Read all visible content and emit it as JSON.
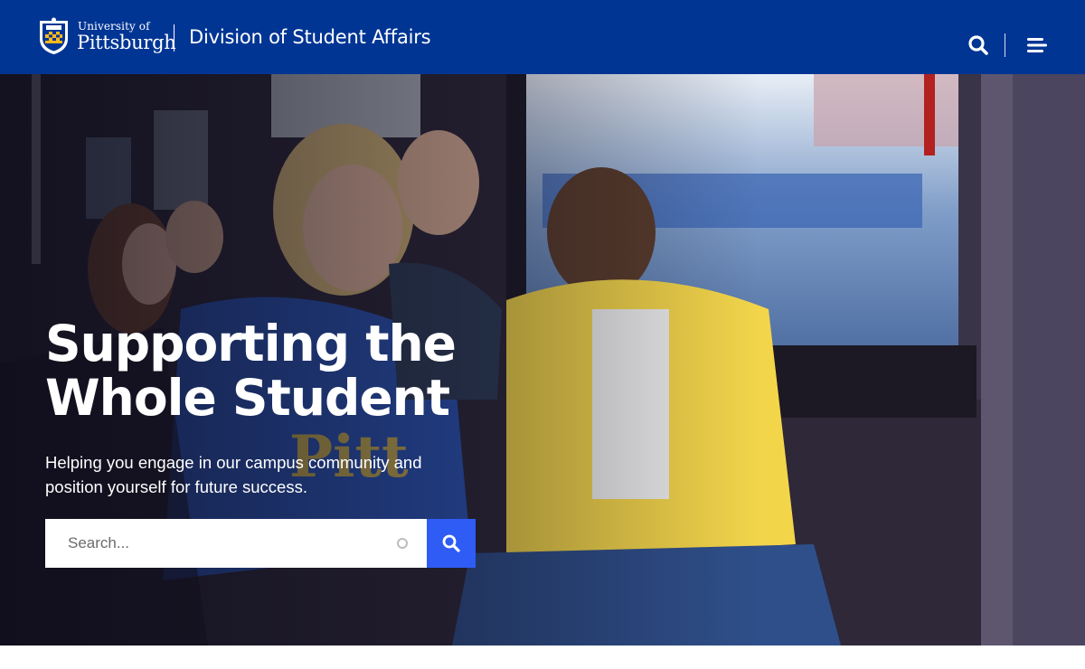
{
  "header": {
    "logo_small": "University of",
    "logo_big": "Pittsburgh",
    "division_title": "Division of Student Affairs",
    "search_icon": "search-icon",
    "menu_icon": "hamburger-menu-icon"
  },
  "hero": {
    "title_line1": "Supporting the",
    "title_line2": "Whole Student",
    "subtitle_line1": "Helping you engage in our campus community and",
    "subtitle_line2": "position yourself for future success.",
    "search_placeholder": "Search...",
    "search_button_icon": "search-icon"
  },
  "colors": {
    "brand_blue": "#003594",
    "search_button": "#2f5cf5"
  }
}
